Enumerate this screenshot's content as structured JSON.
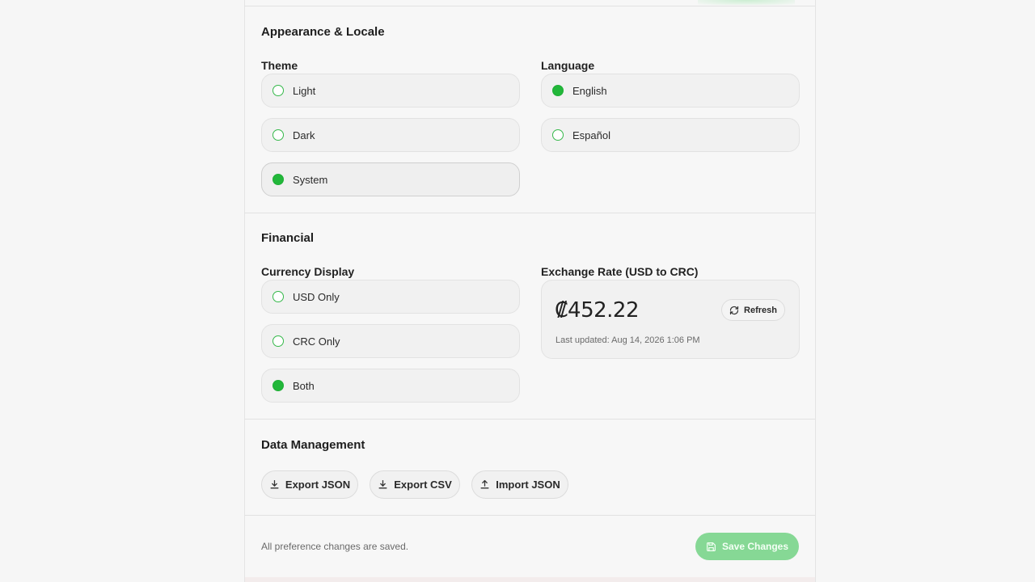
{
  "appearance": {
    "title": "Appearance & Locale",
    "theme": {
      "label": "Theme",
      "options": [
        {
          "label": "Light",
          "selected": false
        },
        {
          "label": "Dark",
          "selected": false
        },
        {
          "label": "System",
          "selected": true
        }
      ]
    },
    "language": {
      "label": "Language",
      "options": [
        {
          "label": "English",
          "selected": true
        },
        {
          "label": "Español",
          "selected": false
        }
      ]
    }
  },
  "financial": {
    "title": "Financial",
    "currency": {
      "label": "Currency Display",
      "options": [
        {
          "label": "USD Only",
          "selected": false
        },
        {
          "label": "CRC Only",
          "selected": false
        },
        {
          "label": "Both",
          "selected": true
        }
      ]
    },
    "exchange": {
      "label": "Exchange Rate (USD to CRC)",
      "value": "₡452.22",
      "updated": "Last updated: Aug 14, 2026 1:06 PM",
      "refresh_label": "Refresh"
    }
  },
  "data_management": {
    "title": "Data Management",
    "buttons": [
      {
        "label": "Export JSON",
        "icon": "download-icon"
      },
      {
        "label": "Export CSV",
        "icon": "download-icon"
      },
      {
        "label": "Import JSON",
        "icon": "upload-icon"
      }
    ]
  },
  "footer": {
    "note": "All preference changes are saved.",
    "save_label": "Save Changes"
  },
  "colors": {
    "accent": "#22b73a",
    "save_button": "#86d895"
  }
}
